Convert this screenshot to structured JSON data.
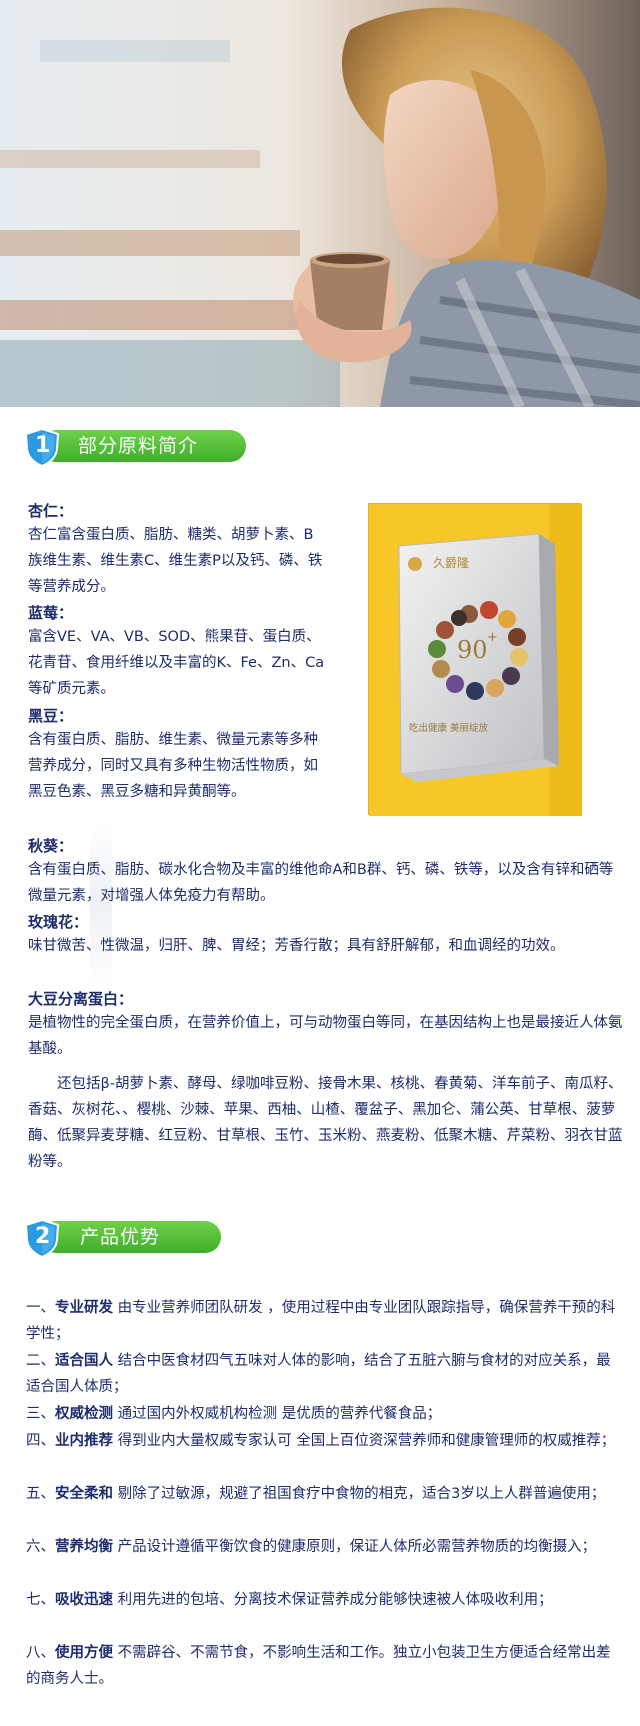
{
  "section1": {
    "number": "1",
    "title": "部分原料简介",
    "ingredients": [
      {
        "name": "杏仁：",
        "desc": "杏仁富含蛋白质、脂肪、糖类、胡萝卜素、B族维生素、维生素C、维生素P以及钙、磷、铁等营养成分。"
      },
      {
        "name": "蓝莓：",
        "desc": "富含VE、VA、VB、SOD、熊果苷、蛋白质、花青苷、食用纤维以及丰富的K、Fe、Zn、Ca等矿质元素。"
      },
      {
        "name": "黑豆：",
        "desc": "含有蛋白质、脂肪、维生素、微量元素等多种营养成分，同时又具有多种生物活性物质，如黑豆色素、黑豆多糖和异黄酮等。"
      },
      {
        "name": "秋葵：",
        "desc": "含有蛋白质、脂肪、碳水化合物及丰富的维他命A和B群、钙、磷、铁等，以及含有锌和硒等微量元素，对增强人体免疫力有帮助。"
      },
      {
        "name": "玫瑰花：",
        "desc": "味甘微苦、性微温，归肝、脾、胃经；芳香行散；具有舒肝解郁，和血调经的功效。"
      },
      {
        "name": "大豆分离蛋白：",
        "desc": "是植物性的完全蛋白质，在营养价值上，可与动物蛋白等同，在基因结构上也是最接近人体氨基酸。"
      }
    ],
    "others": "还包括β-胡萝卜素、酵母、绿咖啡豆粉、接骨木果、核桃、春黄菊、洋车前子、南瓜籽、香菇、灰树花、、樱桃、沙棘、苹果、西柚、山楂、覆盆子、黑加仑、蒲公英、甘草根、菠萝酶、低聚异麦芽糖、红豆粉、甘草根、玉竹、玉米粉、燕麦粉、低聚木糖、芹菜粉、羽衣甘蓝粉等。",
    "product": {
      "brand": "久爵隆",
      "badge": "90",
      "plus": "+",
      "slogan": "吃出健康 美丽绽放"
    }
  },
  "section2": {
    "number": "2",
    "title": "产品优势",
    "items": [
      {
        "prefix": "一、",
        "label": "专业研发",
        "text": " 由专业营养师团队研发 ，使用过程中由专业团队跟踪指导，确保营养干预的科学性；"
      },
      {
        "prefix": "二、",
        "label": "适合国人",
        "text": " 结合中医食材四气五味对人体的影响，结合了五脏六腑与食材的对应关系，最适合国人体质；"
      },
      {
        "prefix": "三、",
        "label": "权威检测",
        "text": " 通过国内外权威机构检测 是优质的营养代餐食品；"
      },
      {
        "prefix": "四、",
        "label": "业内推荐",
        "text": " 得到业内大量权威专家认可 全国上百位资深营养师和健康管理师的权威推荐；"
      },
      {
        "prefix": "五、",
        "label": "安全柔和",
        "text": " 剔除了过敏源，规避了祖国食疗中食物的相克，适合3岁以上人群普遍使用；"
      },
      {
        "prefix": "六、",
        "label": "营养均衡",
        "text": " 产品设计遵循平衡饮食的健康原则，保证人体所必需营养物质的均衡摄入；"
      },
      {
        "prefix": "七、",
        "label": "吸收迅速",
        "text": " 利用先进的包培、分离技术保证营养成分能够快速被人体吸收利用；"
      },
      {
        "prefix": "八、",
        "label": "使用方便",
        "text": " 不需辟谷、不需节食，不影响生活和工作。独立小包装卫生方便适合经常出差的商务人士。"
      }
    ]
  },
  "colors": {
    "text": "#1e2d6e",
    "green": "#3fae2a",
    "shield": "#2a9be0",
    "box": "#f7c72a"
  }
}
